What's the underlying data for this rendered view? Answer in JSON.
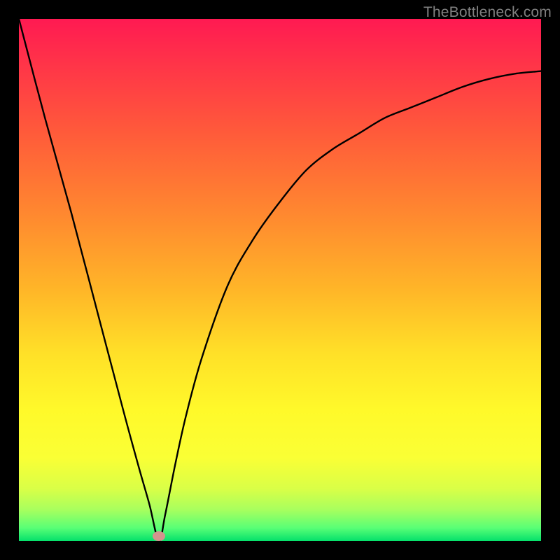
{
  "watermark": "TheBottleneck.com",
  "marker": {
    "x_pct": 26.8,
    "y_pct": 99.0
  },
  "chart_data": {
    "type": "line",
    "title": "",
    "xlabel": "",
    "ylabel": "",
    "xlim": [
      0,
      100
    ],
    "ylim": [
      0,
      100
    ],
    "grid": false,
    "series": [
      {
        "name": "curve",
        "x": [
          0,
          5,
          10,
          15,
          20,
          23,
          25,
          26.8,
          28,
          30,
          32,
          35,
          40,
          45,
          50,
          55,
          60,
          65,
          70,
          75,
          80,
          85,
          90,
          95,
          100
        ],
        "y": [
          100,
          81,
          63,
          44,
          25,
          14,
          7,
          0,
          5,
          15,
          24,
          35,
          49,
          58,
          65,
          71,
          75,
          78,
          81,
          83,
          85,
          87,
          88.5,
          89.5,
          90
        ]
      }
    ],
    "annotations": [
      {
        "type": "marker",
        "x": 26.8,
        "y": 0,
        "color": "#d3948e"
      }
    ],
    "background_gradient": {
      "direction": "vertical",
      "stops": [
        {
          "pct": 0,
          "color": "#ff1a52"
        },
        {
          "pct": 22,
          "color": "#ff5b3a"
        },
        {
          "pct": 52,
          "color": "#ffb628"
        },
        {
          "pct": 75,
          "color": "#fff92a"
        },
        {
          "pct": 94,
          "color": "#a8ff5e"
        },
        {
          "pct": 100,
          "color": "#04e06b"
        }
      ]
    }
  }
}
